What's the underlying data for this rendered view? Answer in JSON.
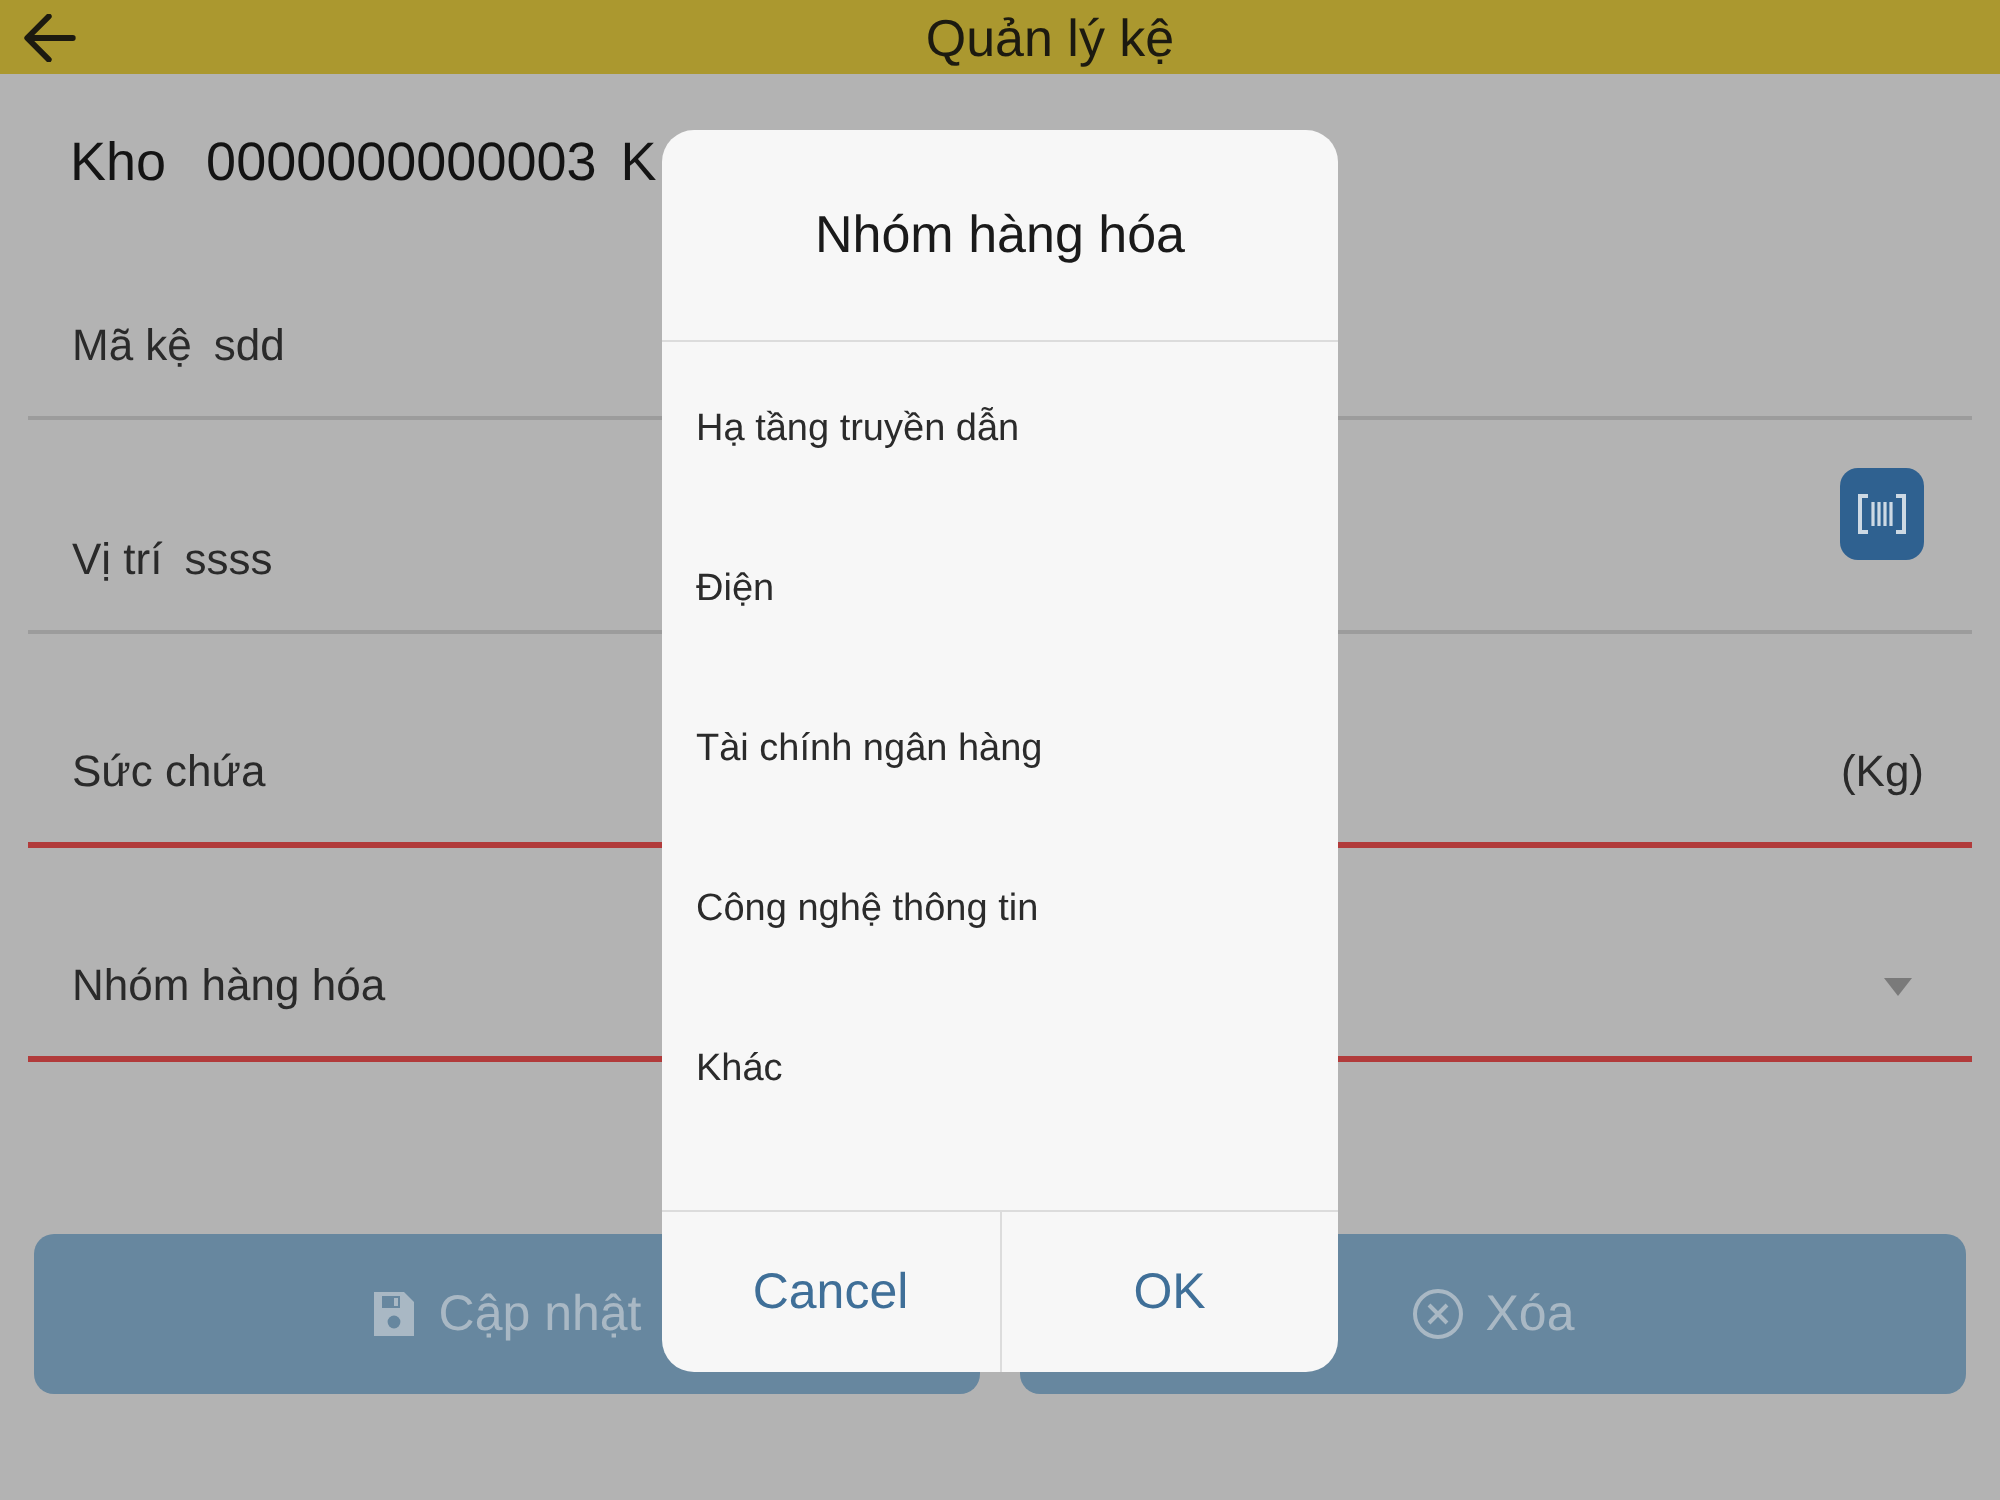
{
  "header": {
    "title": "Quản lý kệ"
  },
  "warehouse": {
    "label": "Kho",
    "code": "0000000000003",
    "label_2": "K"
  },
  "fields": [
    {
      "kind": "text",
      "label": "Mã kệ",
      "value": "sdd",
      "error": false
    },
    {
      "kind": "scan",
      "label": "Vị trí",
      "value": "ssss",
      "error": false
    },
    {
      "kind": "unit",
      "label": "Sức chứa",
      "unit": "(Kg)",
      "error": true
    },
    {
      "kind": "dropdown",
      "label": "Nhóm hàng hóa",
      "error": true
    }
  ],
  "actions": [
    {
      "kind": "save",
      "label": "Cập nhật"
    },
    {
      "kind": "delete",
      "label": "Xóa"
    }
  ],
  "dialog": {
    "title": "Nhóm hàng hóa",
    "options": [
      {
        "label": "Hạ tầng truyền dẫn",
        "selected": false
      },
      {
        "label": "Điện",
        "selected": false
      },
      {
        "label": "Tài chính ngân hàng",
        "selected": false
      },
      {
        "label": "Công nghệ thông tin",
        "selected": false
      },
      {
        "label": "Khác",
        "selected": false
      }
    ],
    "buttons": [
      "Cancel",
      "OK"
    ]
  }
}
